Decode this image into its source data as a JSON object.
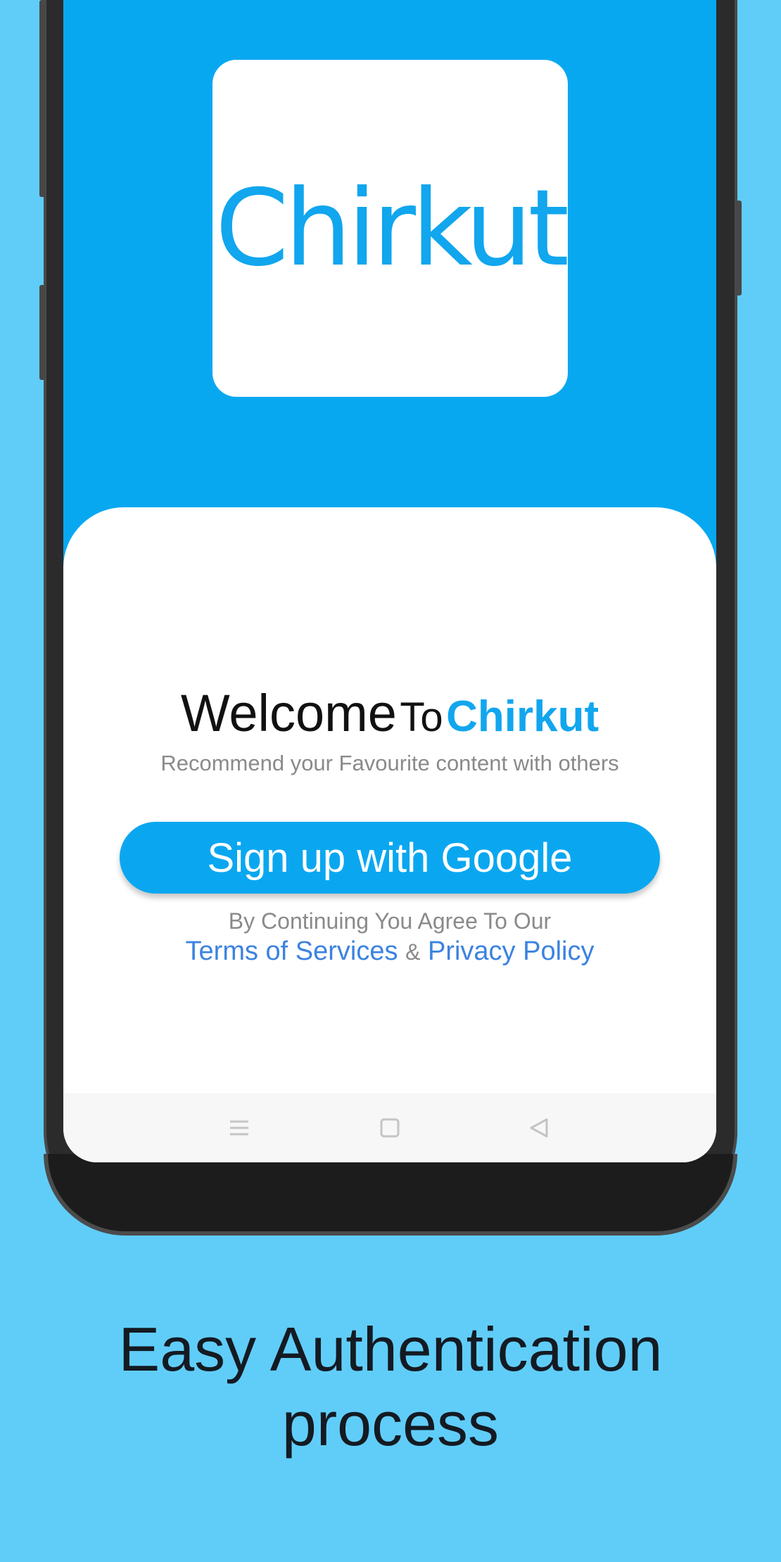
{
  "logo": {
    "text": "Chirkut"
  },
  "welcome": {
    "word1": "Welcome",
    "word2": "To",
    "app_name": "Chirkut",
    "tagline": "Recommend your Favourite content with others"
  },
  "signup": {
    "label": "Sign up with Google"
  },
  "legal": {
    "agree_text": "By Continuing You Agree To Our",
    "terms_label": "Terms of Services",
    "ampersand": "&",
    "privacy_label": "Privacy Policy"
  },
  "navbar": {
    "icons": [
      "menu-icon",
      "home-square-icon",
      "back-triangle-icon"
    ]
  },
  "caption": {
    "line1": "Easy Authentication",
    "line2": "process"
  },
  "colors": {
    "background": "#60cdf8",
    "screen_header": "#08a8f1",
    "brand": "#12a6ee",
    "link": "#3b83e0"
  }
}
